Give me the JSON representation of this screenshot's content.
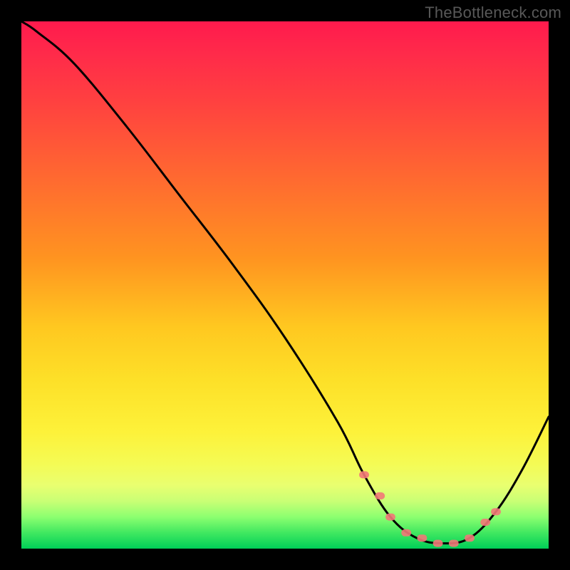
{
  "watermark": "TheBottleneck.com",
  "chart_data": {
    "type": "line",
    "title": "",
    "xlabel": "",
    "ylabel": "",
    "xlim": [
      0,
      100
    ],
    "ylim": [
      0,
      100
    ],
    "grid": false,
    "legend": false,
    "series": [
      {
        "name": "bottleneck-curve",
        "x": [
          0,
          3,
          10,
          20,
          30,
          40,
          50,
          60,
          65,
          70,
          75,
          80,
          85,
          90,
          95,
          100
        ],
        "values": [
          100,
          98,
          92,
          80,
          67,
          54,
          40,
          24,
          14,
          6,
          2,
          1,
          2,
          7,
          15,
          25
        ],
        "color": "#000000"
      }
    ],
    "markers": [
      {
        "name": "optimal-range-dots",
        "series": "bottleneck-curve",
        "x": [
          65,
          68,
          70,
          73,
          76,
          79,
          82,
          85,
          88,
          90
        ],
        "values": [
          14,
          10,
          6,
          3,
          2,
          1,
          1,
          2,
          5,
          7
        ],
        "color": "#f27878",
        "shape": "rounded-rect"
      }
    ],
    "background_gradient": {
      "direction": "vertical",
      "stops": [
        {
          "pos": 0,
          "color": "#ff1a4d"
        },
        {
          "pos": 15,
          "color": "#ff4040"
        },
        {
          "pos": 45,
          "color": "#ff9420"
        },
        {
          "pos": 78,
          "color": "#fdf23a"
        },
        {
          "pos": 94,
          "color": "#8cff70"
        },
        {
          "pos": 100,
          "color": "#00cf58"
        }
      ]
    }
  }
}
